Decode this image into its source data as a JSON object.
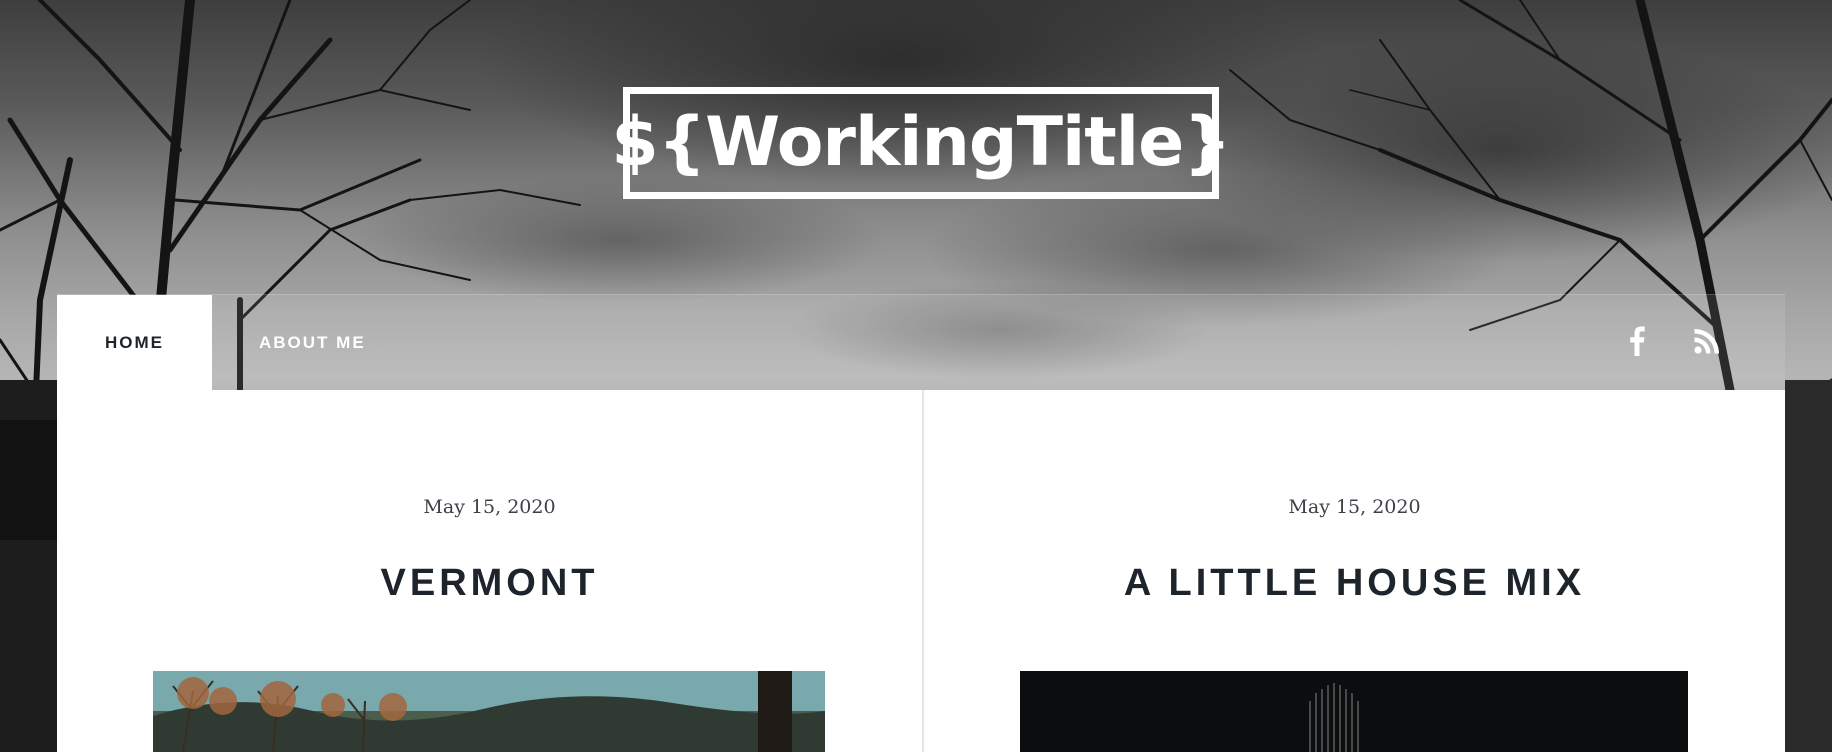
{
  "site": {
    "logo_text": "${WorkingTitle}"
  },
  "nav": {
    "items": [
      {
        "label": "HOME",
        "active": true
      },
      {
        "label": "ABOUT ME",
        "active": false
      }
    ],
    "social": [
      {
        "icon": "facebook-icon"
      },
      {
        "icon": "rss-icon"
      }
    ]
  },
  "posts": [
    {
      "date": "May 15, 2020",
      "title": "VERMONT"
    },
    {
      "date": "May 15, 2020",
      "title": "A LITTLE HOUSE MIX"
    }
  ],
  "colors": {
    "title_text": "#1e242b",
    "date_text": "#3c4148",
    "card_background": "#ffffff",
    "nav_text": "#ffffff"
  }
}
